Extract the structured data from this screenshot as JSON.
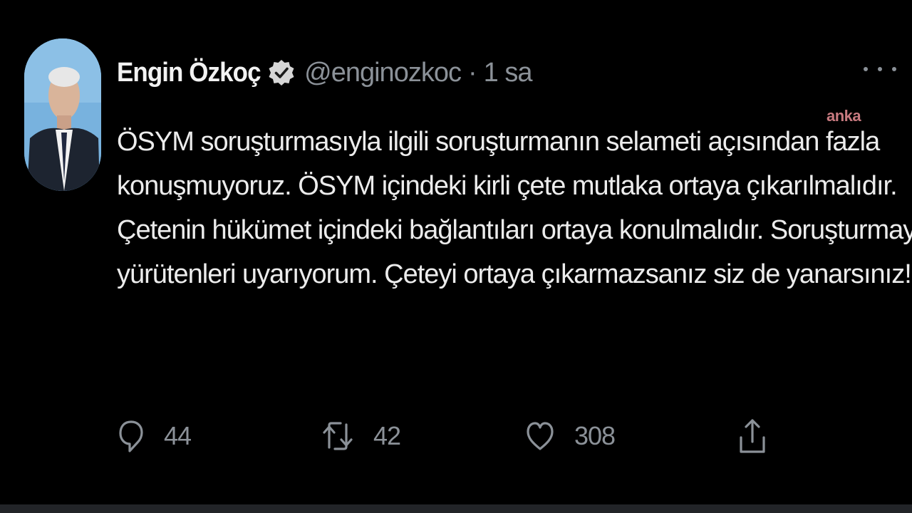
{
  "tweet": {
    "author": {
      "display_name": "Engin Özkoç",
      "handle": "@enginozkoc",
      "verified_icon": "verified-badge-icon"
    },
    "separator": "·",
    "time": "1 sa",
    "text_lines": [
      "ÖSYM soruşturmasıyla ilgili soruşturmanın selameti açısından fazla",
      "konuşmuyoruz. ÖSYM içindeki kirli çete mutlaka ortaya çıkarılmalıdır.",
      "Çetenin hükümet içindeki bağlantıları ortaya konulmalıdır. Soruşturmayı",
      "yürütenleri uyarıyorum. Çeteyi ortaya çıkarmazsanız siz de yanarsınız!"
    ],
    "actions": {
      "reply_count": "44",
      "retweet_count": "42",
      "like_count": "308"
    }
  },
  "watermark": "anka",
  "colors": {
    "background": "#000000",
    "primary_text": "#e7e9ea",
    "secondary_text": "#8b9198",
    "watermark": "#c87a80"
  }
}
